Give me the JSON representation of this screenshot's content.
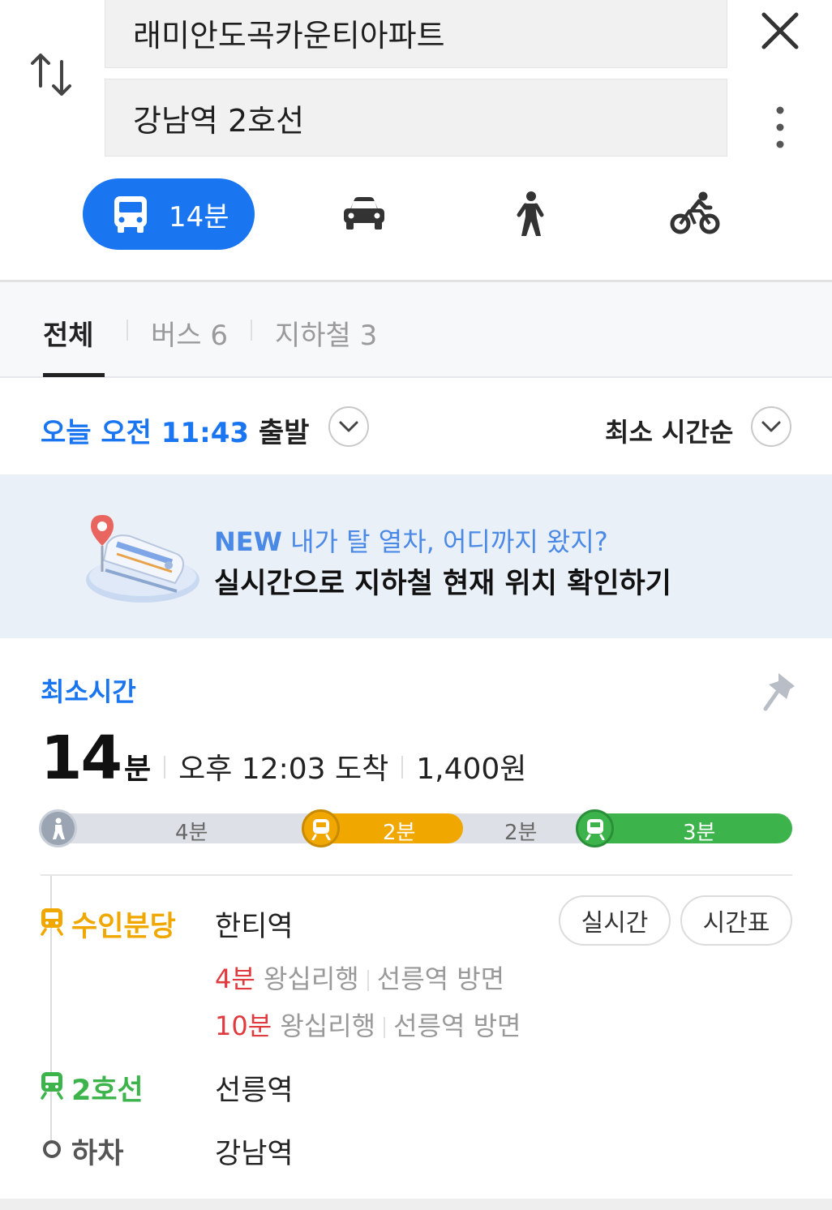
{
  "search": {
    "origin": "래미안도곡카운티아파트",
    "destination": "강남역 2호선"
  },
  "modes": {
    "active_duration": "14분",
    "items": [
      "bus-icon",
      "car-icon",
      "walking-icon",
      "bicycle-icon"
    ]
  },
  "filters": {
    "all": "전체",
    "bus": "버스 6",
    "subway": "지하철 3"
  },
  "departure": {
    "time": "오늘 오전 11:43",
    "suffix": "출발",
    "sort": "최소 시간순"
  },
  "banner": {
    "new_tag": "NEW",
    "line1": "내가 탈 열차, 어디까지 왔지?",
    "line2": "실시간으로 지하철 현재 위치 확인하기"
  },
  "route": {
    "tag": "최소시간",
    "minutes": "14",
    "minutes_unit": "분",
    "arrival": "오후 12:03 도착",
    "fare": "1,400원",
    "segments": {
      "walk": "4분",
      "line1": "2분",
      "transfer": "2분",
      "line2": "3분"
    },
    "steps": {
      "first_line": "수인분당",
      "first_station": "한티역",
      "realtime_btn": "실시간",
      "timetable_btn": "시간표",
      "arrivals": [
        {
          "mins": "4분",
          "dest": "왕십리행",
          "dir": "선릉역 방면"
        },
        {
          "mins": "10분",
          "dest": "왕십리행",
          "dir": "선릉역 방면"
        }
      ],
      "second_line": "2호선",
      "second_station": "선릉역",
      "alight": "하차",
      "alight_station": "강남역"
    }
  },
  "colors": {
    "accent": "#1a75f0",
    "suin_bundang": "#f0a800",
    "line2": "#3cb44b",
    "arrival_red": "#e0393e"
  }
}
